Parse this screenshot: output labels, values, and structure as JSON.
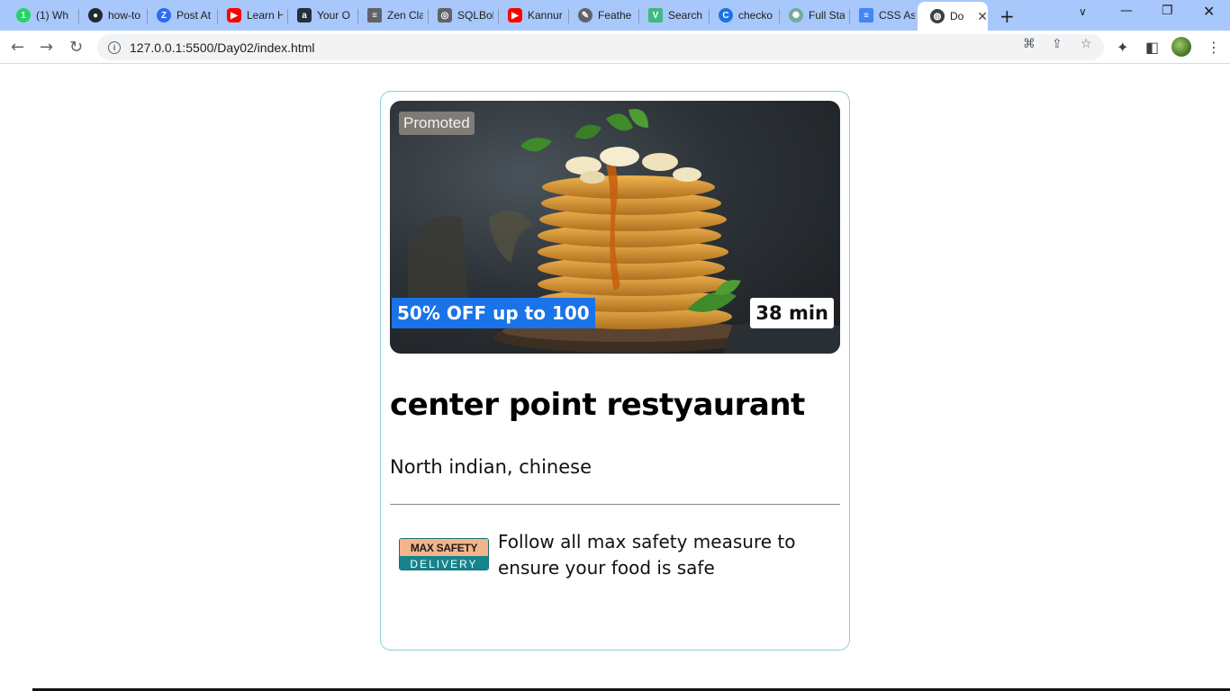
{
  "browser": {
    "tabs": [
      {
        "title": "(1) Wh",
        "icon": "whatsapp-icon",
        "color": "#25d366"
      },
      {
        "title": "how-to",
        "icon": "github-icon",
        "color": "#24292e"
      },
      {
        "title": "Post At",
        "icon": "zoho-icon",
        "color": "#2a6df4"
      },
      {
        "title": "Learn H",
        "icon": "youtube-icon",
        "color": "#ff0000"
      },
      {
        "title": "Your O",
        "icon": "amazon-icon",
        "color": "#232f3e"
      },
      {
        "title": "Zen Cla",
        "icon": "document-icon",
        "color": "#5f6368"
      },
      {
        "title": "SQLBol",
        "icon": "database-icon",
        "color": "#5f6368"
      },
      {
        "title": "Kannur",
        "icon": "youtube-icon",
        "color": "#ff0000"
      },
      {
        "title": "Feathe",
        "icon": "feather-icon",
        "color": "#5f6368"
      },
      {
        "title": "Search",
        "icon": "vue-icon",
        "color": "#41b883"
      },
      {
        "title": "checko",
        "icon": "c-logo-icon",
        "color": "#1a73e8"
      },
      {
        "title": "Full Sta",
        "icon": "chatgpt-icon",
        "color": "#74aa9c"
      },
      {
        "title": "CSS As",
        "icon": "docs-icon",
        "color": "#4285f4"
      },
      {
        "title": "Doc",
        "icon": "globe-icon",
        "color": "#3c4043",
        "active": true
      }
    ],
    "url": "127.0.0.1:5500/Day02/index.html"
  },
  "card": {
    "promoted_label": "Promoted",
    "offer_label": "50% OFF up to 100",
    "time_label": "38 min",
    "title": "center point restyaurant",
    "cuisine": "North indian, chinese",
    "safety_logo_top": "MAX SAFETY",
    "safety_logo_bottom": "DELIVERY",
    "safety_text": "Follow all max safety measure to ensure your food is safe"
  },
  "colors": {
    "offer_badge": "#1a73e8",
    "card_border": "#8ecdd8",
    "safety_teal": "#15848c",
    "safety_peach": "#f4b48a"
  }
}
